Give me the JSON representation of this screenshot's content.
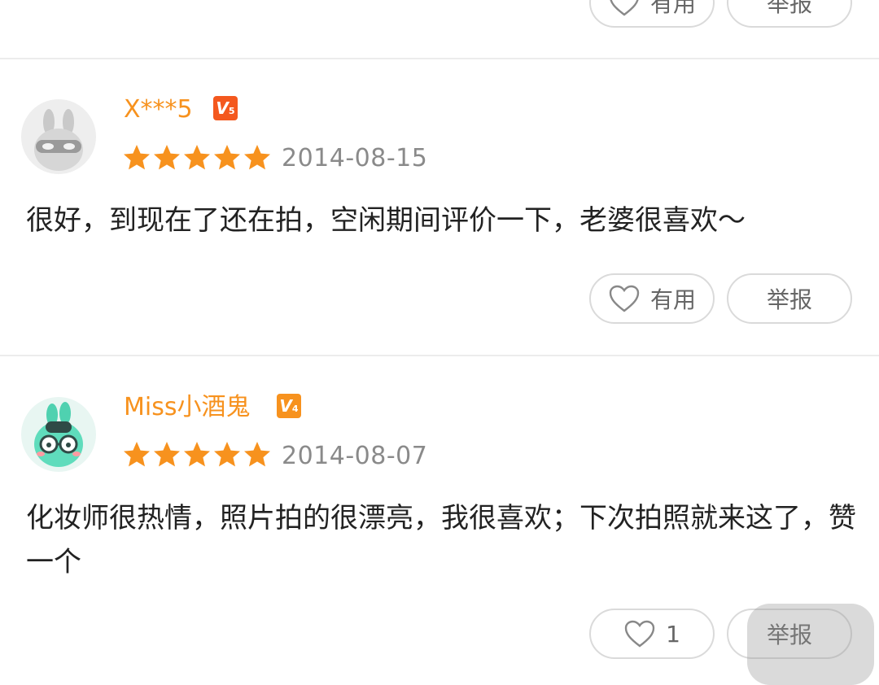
{
  "top_partial": {
    "useful_label": "有用",
    "report_label": "举报"
  },
  "reviews": [
    {
      "username": "X***5",
      "vip_level": "5",
      "vip_color": "#f4581e",
      "rating": 5,
      "date": "2014-08-15",
      "content": "很好，到现在了还在拍，空闲期间评价一下，老婆很喜欢～",
      "useful_label": "有用",
      "report_label": "举报",
      "avatar_icon": "default-masked-bunny-avatar"
    },
    {
      "username": "Miss小酒鬼",
      "vip_level": "4",
      "vip_color": "#f7921e",
      "rating": 5,
      "date": "2014-08-07",
      "content": "化妆师很热情，照片拍的很漂亮，我很喜欢；下次拍照就来这了，赞一个",
      "useful_label": "1",
      "report_label": "举报",
      "avatar_icon": "green-bunny-glasses-avatar"
    }
  ],
  "colors": {
    "accent": "#f7921e",
    "star": "#f7921e",
    "date": "#8a8a8a",
    "divider": "#ececec"
  }
}
